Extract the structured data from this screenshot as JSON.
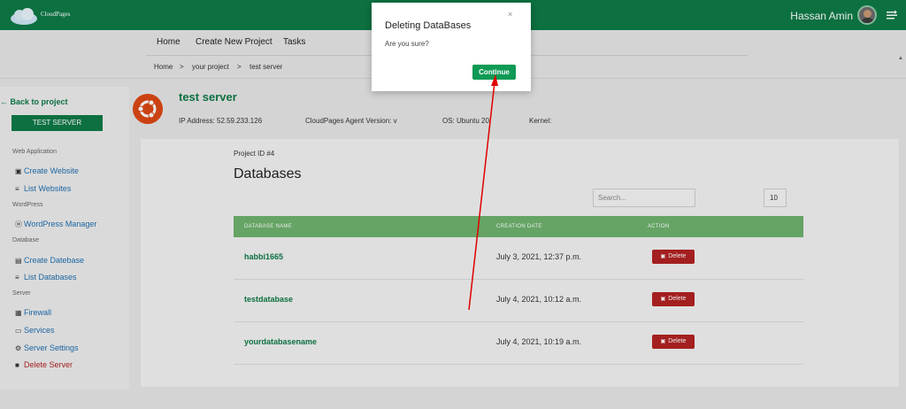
{
  "app": {
    "logo_text": "CloudPages",
    "user_name": "Hassan Amin"
  },
  "nav": {
    "items": [
      "Home",
      "Create New Project",
      "Tasks"
    ]
  },
  "breadcrumb": [
    "Home",
    ">",
    "your project",
    ">",
    "test server"
  ],
  "sidebar": {
    "back_label": "Back to project",
    "server_button": "TEST SERVER",
    "sections": [
      {
        "heading": "Web Application",
        "items": [
          {
            "label": "Create Website",
            "icon": "window-icon"
          },
          {
            "label": "List Websites",
            "icon": "list-icon"
          }
        ]
      },
      {
        "heading": "WordPress",
        "items": [
          {
            "label": "WordPress Manager",
            "icon": "wordpress-icon"
          }
        ]
      },
      {
        "heading": "Database",
        "items": [
          {
            "label": "Create Datebase",
            "icon": "database-icon"
          },
          {
            "label": "List Databases",
            "icon": "list-icon"
          }
        ]
      },
      {
        "heading": "Server",
        "items": [
          {
            "label": "Firewall",
            "icon": "firewall-icon"
          },
          {
            "label": "Services",
            "icon": "services-icon"
          },
          {
            "label": "Server Settings",
            "icon": "gear-icon"
          },
          {
            "label": "Delete Server",
            "icon": "trash-icon"
          }
        ]
      }
    ]
  },
  "server": {
    "title": "test server",
    "ip": "IP Address: 52.59.233.126",
    "agent": "CloudPages Agent Version: v",
    "os": "OS: Ubuntu 20",
    "kernel": "Kernel:"
  },
  "main": {
    "project_id": "Project ID #4",
    "title": "Databases",
    "search_placeholder": "Search...",
    "page_size": "10",
    "columns": [
      "DATABASE NAME",
      "CREATION DATE",
      "ACTION"
    ],
    "rows": [
      {
        "name": "habbi1665",
        "date": "July 3, 2021, 12:37 p.m.",
        "action": "Delete"
      },
      {
        "name": "testdatabase",
        "date": "July 4, 2021, 10:12 a.m.",
        "action": "Delete"
      },
      {
        "name": "yourdatabasename",
        "date": "July 4, 2021, 10:19 a.m.",
        "action": "Delete"
      }
    ]
  },
  "modal": {
    "title": "Deleting DataBases",
    "text": "Are you sure?",
    "close": "×",
    "confirm": "Continue"
  },
  "colors": {
    "brand_green": "#0e7a46",
    "table_header": "#6eb26e",
    "danger": "#b22222",
    "annotation_arrow": "#e00000"
  }
}
